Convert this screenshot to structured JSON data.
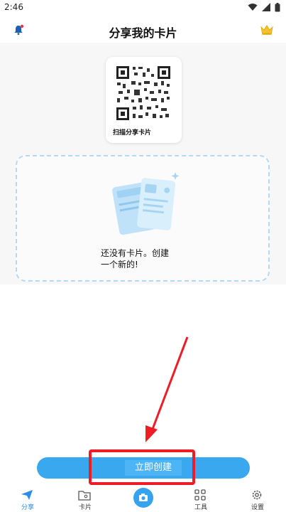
{
  "status_bar": {
    "time": "2:46"
  },
  "header": {
    "title": "分享我的卡片"
  },
  "qr_card": {
    "label": "扫描分享卡片"
  },
  "empty_state": {
    "line1": "还没有卡片。创建",
    "line2": "一个新的!"
  },
  "create_button": {
    "label": "立即创建"
  },
  "bottom_nav": {
    "items": [
      {
        "label": "分享",
        "icon": "send-icon"
      },
      {
        "label": "卡片",
        "icon": "card-folder-icon"
      },
      {
        "label": "",
        "icon": "camera-icon"
      },
      {
        "label": "工具",
        "icon": "grid-icon"
      },
      {
        "label": "设置",
        "icon": "gear-icon"
      }
    ]
  },
  "colors": {
    "accent": "#39a8ef",
    "highlight": "#ee1c25",
    "crown": "#f2c12e"
  }
}
